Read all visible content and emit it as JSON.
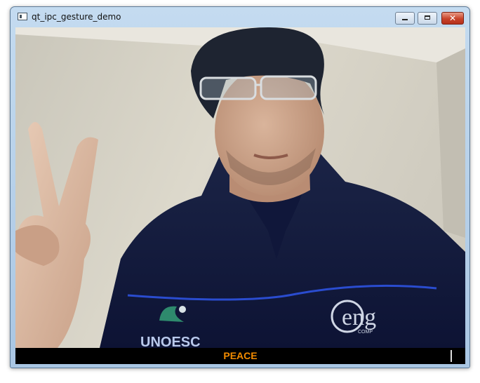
{
  "window": {
    "title": "qt_ipc_gesture_demo",
    "controls": {
      "minimize": "minimize-icon",
      "maximize": "maximize-icon",
      "close": "close-icon"
    }
  },
  "camera": {
    "gesture_label": "PEACE",
    "jacket_texts": [
      "UNOESC",
      "eng",
      "COMP"
    ]
  },
  "colors": {
    "gesture_text": "#f28b00",
    "bar_background": "#000000",
    "window_frame": "#b7d0ea"
  }
}
